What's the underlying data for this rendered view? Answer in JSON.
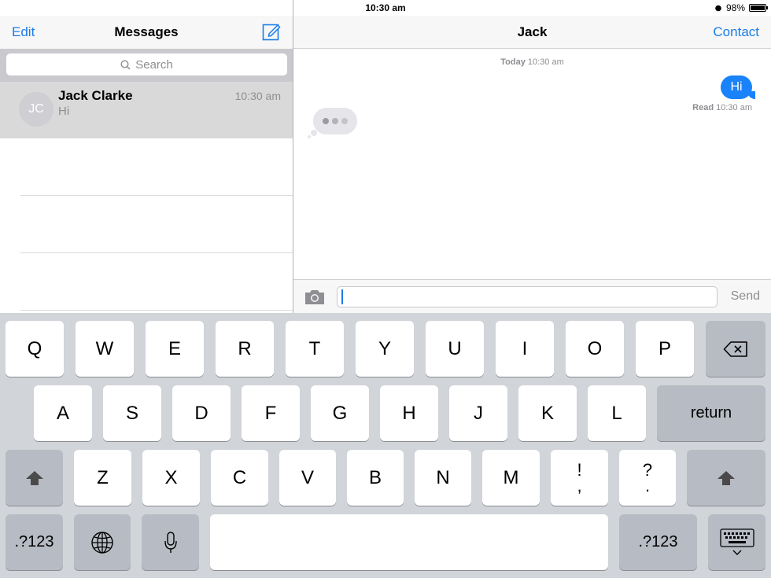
{
  "status_bar": {
    "device": "iPad",
    "time": "10:30 am",
    "battery": "98%",
    "battery_level": 0.98
  },
  "left_nav": {
    "edit": "Edit",
    "title": "Messages"
  },
  "search": {
    "placeholder": "Search"
  },
  "conversation": {
    "initials": "JC",
    "name": "Jack Clarke",
    "time": "10:30 am",
    "preview": "Hi"
  },
  "right_nav": {
    "title": "Jack",
    "contact": "Contact"
  },
  "thread": {
    "stamp_day": "Today",
    "stamp_time": "10:30 am",
    "message_text": "Hi",
    "read_label": "Read",
    "read_time": "10:30 am"
  },
  "input": {
    "value": "",
    "send": "Send"
  },
  "keyboard": {
    "row1": [
      "Q",
      "W",
      "E",
      "R",
      "T",
      "Y",
      "U",
      "I",
      "O",
      "P"
    ],
    "row2": [
      "A",
      "S",
      "D",
      "F",
      "G",
      "H",
      "J",
      "K",
      "L"
    ],
    "row3": [
      "Z",
      "X",
      "C",
      "V",
      "B",
      "N",
      "M"
    ],
    "return": "return",
    "punct1_top": "!",
    "punct1_bottom": ",",
    "punct2_top": "?",
    "punct2_bottom": ".",
    "numbers": ".?123"
  }
}
